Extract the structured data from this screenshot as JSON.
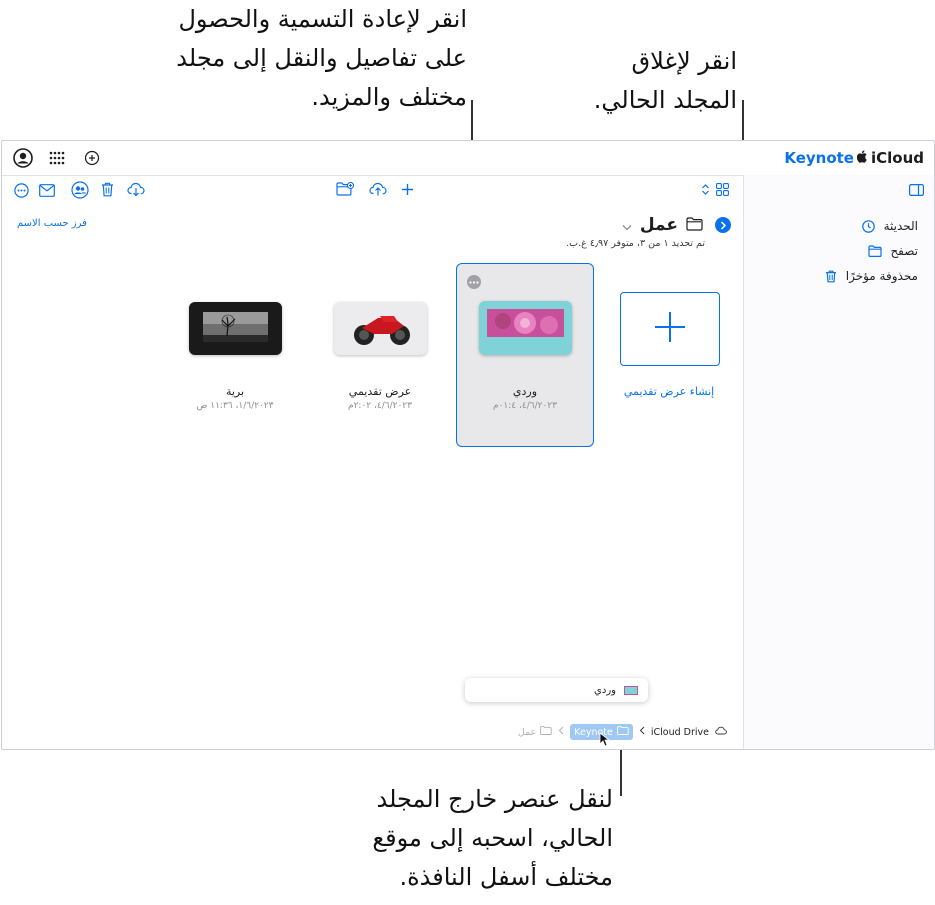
{
  "callouts": {
    "rename": [
      "انقر لإعادة التسمية والحصول",
      "على تفاصيل والنقل إلى مجلد",
      "مختلف والمزيد."
    ],
    "close_folder": [
      "انقر لإغلاق",
      "المجلد الحالي."
    ],
    "move_item": [
      "لنقل عنصر خارج المجلد",
      "الحالي، اسحبه إلى موقع",
      "مختلف أسفل النافذة."
    ]
  },
  "app": {
    "title": "Keynote",
    "brand": "iCloud"
  },
  "sidebar": {
    "items": [
      {
        "label": "الحديثة",
        "icon": "clock-icon"
      },
      {
        "label": "تصفح",
        "icon": "folder-icon"
      },
      {
        "label": "محذوفة مؤخرًا",
        "icon": "trash-icon"
      }
    ]
  },
  "folder": {
    "name": "عمل",
    "status": "تم تحديد ١ من ٣، متوفر ٤٫٩٧ غ.ب.",
    "sort_label": "فرز حسب الاسم"
  },
  "tiles": [
    {
      "name": "إنشاء عرض تقديمي",
      "date": "",
      "type": "create"
    },
    {
      "name": "وردي",
      "date": "٤/٦/٢٠٢٣، ٠١:٤م",
      "type": "pink",
      "selected": true
    },
    {
      "name": "عرض تقديمي",
      "date": "٤/٦/٢٠٢٣، ٢:٠٢م",
      "type": "motorcycle"
    },
    {
      "name": "برية",
      "date": "١/٦/٢٠٢٣، ١١:٣٦ ص",
      "type": "tree"
    }
  ],
  "drag": {
    "label": "وردي"
  },
  "path": {
    "root": "iCloud Drive",
    "keynote": "Keynote",
    "current": "عمل"
  },
  "colors": {
    "accent": "#0a72e8",
    "selection": "#e8e8ea"
  }
}
